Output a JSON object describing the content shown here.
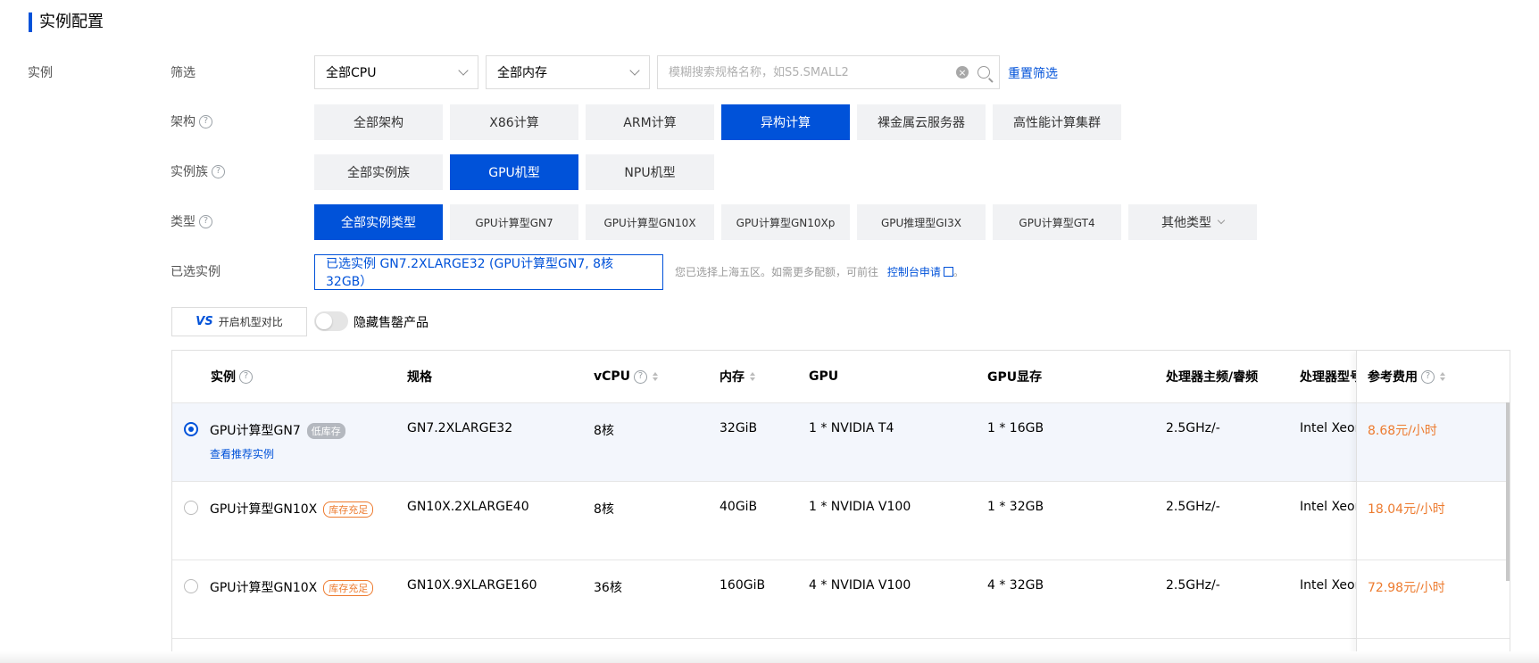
{
  "section_title": "实例配置",
  "left_label": "实例",
  "filter": {
    "label": "筛选",
    "cpu_select": "全部CPU",
    "mem_select": "全部内存",
    "search_placeholder": "模糊搜索规格名称，如S5.SMALL2",
    "reset_label": "重置筛选"
  },
  "arch": {
    "label": "架构",
    "options": [
      "全部架构",
      "X86计算",
      "ARM计算",
      "异构计算",
      "裸金属云服务器",
      "高性能计算集群"
    ],
    "selected": "异构计算"
  },
  "family": {
    "label": "实例族",
    "options": [
      "全部实例族",
      "GPU机型",
      "NPU机型"
    ],
    "selected": "GPU机型"
  },
  "type": {
    "label": "类型",
    "options": [
      "全部实例类型",
      "GPU计算型GN7",
      "GPU计算型GN10X",
      "GPU计算型GN10Xp",
      "GPU推理型GI3X",
      "GPU计算型GT4",
      "其他类型"
    ],
    "selected": "全部实例类型"
  },
  "selected_instance": {
    "label": "已选实例",
    "value": "已选实例  GN7.2XLARGE32 (GPU计算型GN7, 8核32GB）",
    "note": "您已选择上海五区。如需更多配额，可前往",
    "note_link": "控制台申请",
    "note_end": "。"
  },
  "compare_button": "开启机型对比",
  "compare_icon_text": "VS",
  "hide_soldout_label": "隐藏售罄产品",
  "table": {
    "headers": {
      "instance": "实例",
      "spec": "规格",
      "vcpu": "vCPU",
      "memory": "内存",
      "gpu": "GPU",
      "gpu_mem": "GPU显存",
      "freq": "处理器主频/睿频",
      "cpu_model": "处理器型号",
      "price": "参考费用"
    },
    "rows": [
      {
        "name": "GPU计算型GN7",
        "badge": "低库存",
        "badge_type": "gray",
        "sub_link": "查看推荐实例",
        "spec": "GN7.2XLARGE32",
        "vcpu": "8核",
        "memory": "32GiB",
        "gpu": "1 * NVIDIA T4",
        "gpu_mem": "1 * 16GB",
        "freq": "2.5GHz/-",
        "cpu_model": "Intel Xeon",
        "price": "8.68元/小时",
        "selected": true
      },
      {
        "name": "GPU计算型GN10X",
        "badge": "库存充足",
        "badge_type": "orange",
        "sub_link": "",
        "spec": "GN10X.2XLARGE40",
        "vcpu": "8核",
        "memory": "40GiB",
        "gpu": "1 * NVIDIA V100",
        "gpu_mem": "1 * 32GB",
        "freq": "2.5GHz/-",
        "cpu_model": "Intel Xeon",
        "price": "18.04元/小时",
        "selected": false
      },
      {
        "name": "GPU计算型GN10X",
        "badge": "库存充足",
        "badge_type": "orange",
        "sub_link": "",
        "spec": "GN10X.9XLARGE160",
        "vcpu": "36核",
        "memory": "160GiB",
        "gpu": "4 * NVIDIA V100",
        "gpu_mem": "4 * 32GB",
        "freq": "2.5GHz/-",
        "cpu_model": "Intel Xeon",
        "price": "72.98元/小时",
        "selected": false
      }
    ]
  },
  "colors": {
    "primary": "#0052d9",
    "price": "#ed7b2f",
    "badge_gray": "#b4b8bf"
  }
}
